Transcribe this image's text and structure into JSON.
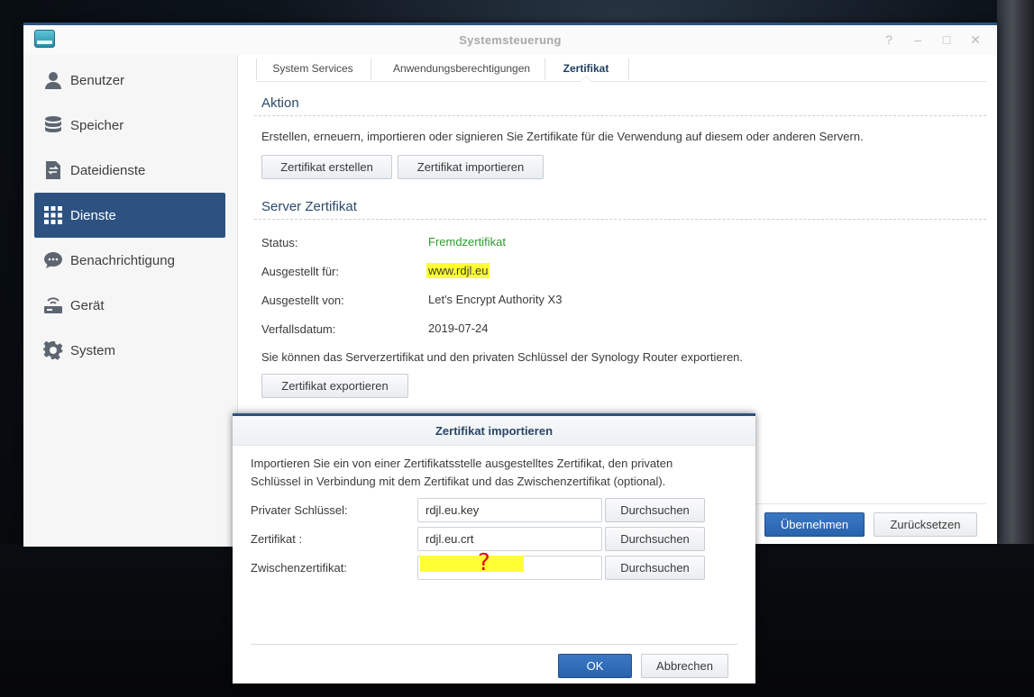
{
  "window": {
    "title": "Systemsteuerung",
    "controls": [
      "?",
      "–",
      "□",
      "✕"
    ]
  },
  "sidebar": {
    "items": [
      {
        "label": "Benutzer",
        "icon": "user-icon"
      },
      {
        "label": "Speicher",
        "icon": "database-icon"
      },
      {
        "label": "Dateidienste",
        "icon": "file-transfer-icon"
      },
      {
        "label": "Dienste",
        "icon": "grid-icon",
        "active": true
      },
      {
        "label": "Benachrichtigung",
        "icon": "chat-bubble-icon"
      },
      {
        "label": "Gerät",
        "icon": "router-icon"
      },
      {
        "label": "System",
        "icon": "gear-icon"
      }
    ]
  },
  "tabs": {
    "items": [
      "System Services",
      "Anwendungsberechtigungen",
      "Zertifikat"
    ],
    "active_index": 2
  },
  "aktion": {
    "title": "Aktion",
    "description": "Erstellen, erneuern, importieren oder signieren Sie Zertifikate für die Verwendung auf diesem oder anderen Servern.",
    "create_button": "Zertifikat erstellen",
    "import_button": "Zertifikat importieren"
  },
  "server_cert": {
    "title": "Server Zertifikat",
    "status_label": "Status:",
    "status_value": "Fremdzertifikat",
    "issued_to_label": "Ausgestellt für:",
    "issued_to_value": "www.rdjl.eu",
    "issued_by_label": "Ausgestellt von:",
    "issued_by_value": "Let's Encrypt Authority X3",
    "expiry_label": "Verfallsdatum:",
    "expiry_value": "2019-07-24",
    "export_note": "Sie können das Serverzertifikat und den privaten Schlüssel der Synology Router exportieren.",
    "export_button": "Zertifikat exportieren"
  },
  "footer": {
    "apply_button": "Übernehmen",
    "reset_button": "Zurücksetzen"
  },
  "dialog": {
    "title": "Zertifikat importieren",
    "description_line1": "Importieren Sie ein von einer Zertifikatsstelle ausgestelltes Zertifikat, den privaten",
    "description_line2": "Schlüssel in Verbindung mit dem Zertifikat und das Zwischenzertifikat (optional).",
    "private_key_label": "Privater Schlüssel:",
    "private_key_value": "rdjl.eu.key",
    "cert_label": "Zertifikat :",
    "cert_value": "rdjl.eu.crt",
    "intermediate_label": "Zwischenzertifikat:",
    "intermediate_value": "",
    "browse_button": "Durchsuchen",
    "annotation": "?",
    "ok_button": "OK",
    "cancel_button": "Abbrechen"
  },
  "colors": {
    "accent": "#2d5282",
    "status_green": "#2e9b2e",
    "highlight": "#ffff33",
    "annotation_red": "#e01010"
  }
}
